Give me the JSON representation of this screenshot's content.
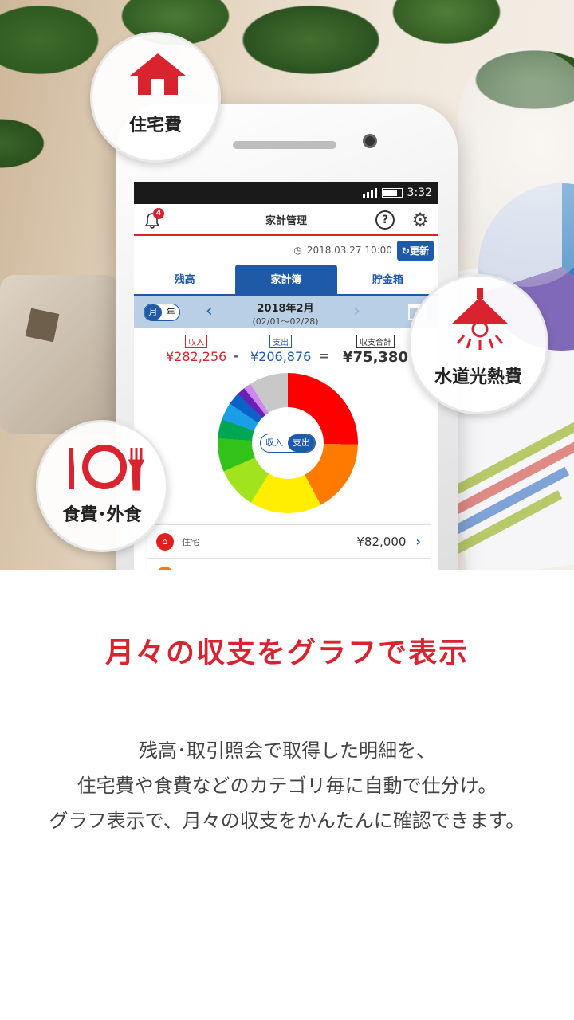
{
  "status_bar": {
    "time": "3:32"
  },
  "app": {
    "title": "家計管理",
    "notification_count": "4",
    "updated": "2018.03.27 10:00",
    "refresh_label": "更新"
  },
  "tabs": [
    {
      "label": "残高"
    },
    {
      "label": "家計簿"
    },
    {
      "label": "貯金箱"
    }
  ],
  "period": {
    "toggle_month": "月",
    "toggle_year": "年",
    "month": "2018年2月",
    "range": "(02/01〜02/28)"
  },
  "summary": {
    "income_label": "収入",
    "income_value": "¥282,256",
    "minus": "-",
    "expense_label": "支出",
    "expense_value": "¥206,876",
    "equals": "=",
    "total_label": "収支合計",
    "total_value": "¥75,380"
  },
  "donut_toggle": {
    "income": "収入",
    "expense": "支出"
  },
  "list": [
    {
      "name": "住宅",
      "amount": "¥82,000"
    }
  ],
  "bubbles": {
    "housing": "住宅費",
    "utilities": "水道光熱費",
    "food": "食費･外食"
  },
  "main_title": "月々の収支をグラフで表示",
  "description": [
    "残高･取引照会で取得した明細を、",
    "住宅費や食費などのカテゴリ毎に自動で仕分け。",
    "グラフ表示で、月々の収支をかんたんに確認できます。"
  ],
  "colors": {
    "accent_red": "#d9232e",
    "accent_blue": "#1e5aa8"
  }
}
